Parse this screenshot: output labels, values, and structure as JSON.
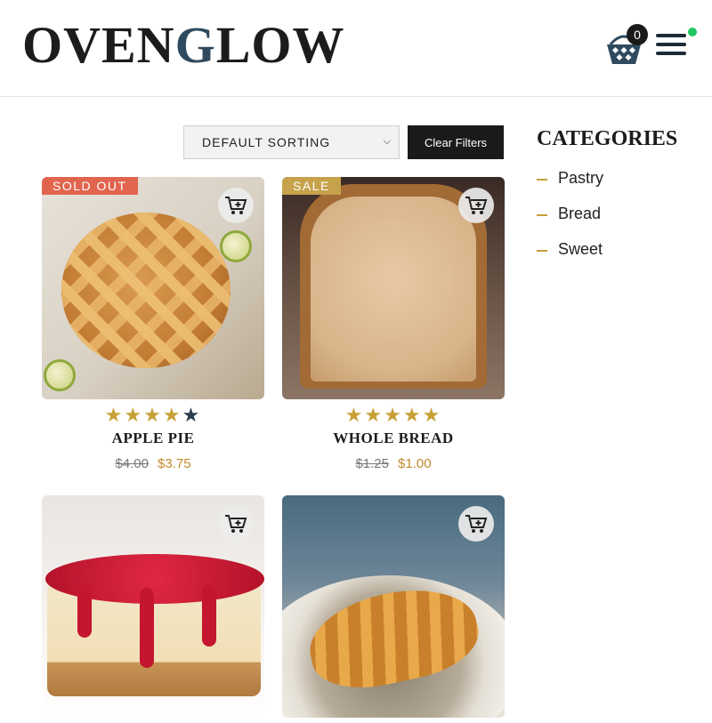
{
  "brand": {
    "logo_text_1": "OVEN",
    "logo_text_g": "G",
    "logo_text_2": "LOW"
  },
  "header": {
    "cart_count": "0",
    "status_dot_color": "#22c55e"
  },
  "toolbar": {
    "sorting_value": "DEFAULT SORTING",
    "clear_filters_label": "Clear Filters"
  },
  "sidebar": {
    "title": "CATEGORIES",
    "items": [
      {
        "label": "Pastry"
      },
      {
        "label": "Bread"
      },
      {
        "label": "Sweet"
      }
    ]
  },
  "products": [
    {
      "name": "APPLE PIE",
      "badge": "SOLD OUT",
      "old_price": "$4.00",
      "new_price": "$3.75",
      "rating": 4,
      "rating_max": 5,
      "image": "apple-pie"
    },
    {
      "name": "WHOLE BREAD",
      "badge": "SALE",
      "old_price": "$1.25",
      "new_price": "$1.00",
      "rating": 5,
      "rating_max": 5,
      "image": "whole-bread"
    },
    {
      "name": "",
      "badge": "",
      "image": "cheesecake"
    },
    {
      "name": "",
      "badge": "",
      "image": "croissant"
    }
  ],
  "colors": {
    "accent_gold": "#c9a036",
    "sold_out_badge": "#e1654e",
    "sale_badge": "#c6a24a",
    "dark": "#1a1a1a"
  }
}
